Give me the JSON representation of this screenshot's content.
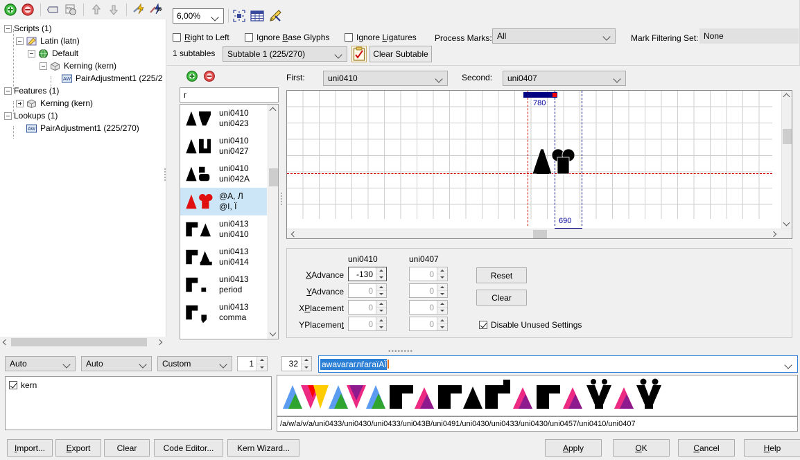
{
  "tree_toolbar": {
    "icons": [
      "add-icon",
      "remove-icon",
      "edit-icon",
      "xyz-icon",
      "move-up-icon",
      "move-down-icon",
      "merge-icon",
      "revert-icon"
    ],
    "overflow_label": "»"
  },
  "tree": {
    "nodes": [
      {
        "label": "Scripts (1)",
        "icon": "none",
        "depth": 0,
        "expander": "minus",
        "selected": false
      },
      {
        "label": "Latin (latn)",
        "icon": "script-icon",
        "depth": 1,
        "expander": "minus",
        "selected": false
      },
      {
        "label": "Default",
        "icon": "globe-icon",
        "depth": 2,
        "expander": "minus",
        "selected": false
      },
      {
        "label": "Kerning (kern)",
        "icon": "feature-icon",
        "depth": 3,
        "expander": "minus",
        "selected": false
      },
      {
        "label": "PairAdjustment1 (225/2",
        "icon": "lookup-icon",
        "depth": 4,
        "expander": "leaf",
        "selected": false
      },
      {
        "label": "Features (1)",
        "icon": "none",
        "depth": 0,
        "expander": "minus",
        "selected": false
      },
      {
        "label": "Kerning (kern)",
        "icon": "feature-icon",
        "depth": 1,
        "expander": "plus",
        "selected": false
      },
      {
        "label": "Lookups (1)",
        "icon": "none",
        "depth": 0,
        "expander": "minus",
        "selected": false
      },
      {
        "label": "PairAdjustment1 (225/270)",
        "icon": "lookup-icon",
        "depth": 1,
        "expander": "leaf",
        "selected": false
      }
    ]
  },
  "topbar": {
    "zoom_value": "6,00%",
    "icons": [
      "fit-to-selection-icon",
      "table-view-icon",
      "pen-edit-icon",
      "clipboard-icon"
    ],
    "checkboxes": [
      {
        "label": "Right to Left",
        "underline_index": 0,
        "checked": false
      },
      {
        "label": "Ignore Base Glyphs",
        "underline_index": 7,
        "checked": false
      },
      {
        "label": "Ignore Ligatures",
        "underline_index": 7,
        "checked": false
      }
    ],
    "process_marks_label": "Process Marks:",
    "process_marks_value": "All",
    "mark_filtering_label": "Mark Filtering Set:",
    "mark_filtering_value": "None",
    "subtable_count_label": "1 subtables",
    "subtable_value": "Subtable 1 (225/270)",
    "clear_subtable_label": "Clear Subtable"
  },
  "glyph_list": {
    "search_value": "г",
    "add_icon": "add-pair-icon",
    "remove_icon": "remove-pair-icon",
    "rows": [
      {
        "first": "uni0410",
        "second": "uni0423",
        "selected": false,
        "preview": "AT"
      },
      {
        "first": "uni0410",
        "second": "uni0427",
        "selected": false,
        "preview": "AU"
      },
      {
        "first": "uni0410",
        "second": "uni042A",
        "selected": false,
        "preview": "AB"
      },
      {
        "first": "@A, Л",
        "second": "@I, Ї",
        "selected": true,
        "preview": "AY"
      },
      {
        "first": "uni0413",
        "second": "uni0410",
        "selected": false,
        "preview": "GA"
      },
      {
        "first": "uni0413",
        "second": "uni0414",
        "selected": false,
        "preview": "GD"
      },
      {
        "first": "uni0413",
        "second": "period",
        "selected": false,
        "preview": "G."
      },
      {
        "first": "uni0413",
        "second": "comma",
        "selected": false,
        "preview": "G,"
      }
    ]
  },
  "pair": {
    "first_label": "First:",
    "first_value": "uni0410",
    "second_label": "Second:",
    "second_value": "uni0407",
    "first_advance": "780",
    "second_advance": "690"
  },
  "values": {
    "col1_header": "uni0410",
    "col2_header": "uni0407",
    "rows": [
      {
        "label": "XAdvance",
        "underline_index": 0,
        "col1": "-130",
        "col2": "0",
        "col1_enabled": true,
        "col2_enabled": false
      },
      {
        "label": "YAdvance",
        "underline_index": 0,
        "col1": "0",
        "col2": "0",
        "col1_enabled": false,
        "col2_enabled": false
      },
      {
        "label": "XPlacement",
        "underline_index": 1,
        "col1": "0",
        "col2": "0",
        "col1_enabled": false,
        "col2_enabled": false
      },
      {
        "label": "YPlacement",
        "underline_index": 9,
        "col1": "0",
        "col2": "0",
        "col1_enabled": false,
        "col2_enabled": false
      }
    ],
    "reset_label": "Reset",
    "clear_label": "Clear",
    "disable_unused_label": "Disable Unused Settings",
    "disable_unused_checked": true
  },
  "bottom": {
    "combo1": "Auto",
    "combo2": "Auto",
    "combo3": "Custom",
    "spin1": "1",
    "spin2": "32",
    "sample_text": "awavaгaглѓaгaїАЇ",
    "feature_items": [
      {
        "label": "kern",
        "checked": true
      }
    ],
    "glyph_names": "/a/w/a/v/a/uni0433/uni0430/uni0433/uni043B/uni0491/uni0430/uni0433/uni0430/uni0457/uni0410/uni0407"
  },
  "footer": {
    "left_buttons": [
      {
        "label": "Import...",
        "underline_index": 0
      },
      {
        "label": "Export",
        "underline_index": 0
      },
      {
        "label": "Clear",
        "underline_index": -1
      },
      {
        "label": "Code Editor...",
        "underline_index": -1
      },
      {
        "label": "Kern Wizard...",
        "underline_index": -1
      }
    ],
    "right_buttons": [
      {
        "label": "Apply",
        "underline_index": 0
      },
      {
        "label": "OK",
        "underline_index": 0
      },
      {
        "label": "Cancel",
        "underline_index": 0
      },
      {
        "label": "Help",
        "underline_index": 0
      }
    ]
  },
  "colors": {
    "accent_blue": "#2b7fd4",
    "advance_bar": "#000080",
    "handle_red": "#ff0000",
    "baseline_red": "#d40000",
    "selection": "#cce6f7",
    "glyph_pink": "#ec2a84",
    "glyph_purple": "#8e1b8e",
    "glyph_blue": "#5b9bf0",
    "glyph_green": "#2fa52f",
    "glyph_yellow": "#ffcc00",
    "glyph_red": "#ff0000",
    "glyph_black": "#000000"
  },
  "glyph_strip": {
    "glyphs": [
      {
        "shape": "aw",
        "colors": [
          "#5b9bf0",
          "#2fa52f",
          "#ec2a84",
          "#ff0000",
          "#ffcc00"
        ]
      },
      {
        "shape": "av",
        "colors": [
          "#5b9bf0",
          "#2fa52f",
          "#8e1b8e",
          "#ec2a84"
        ]
      },
      {
        "shape": "a",
        "colors": [
          "#5b9bf0",
          "#2fa52f"
        ]
      },
      {
        "shape": "g",
        "colors": [
          "#000000"
        ]
      },
      {
        "shape": "a",
        "colors": [
          "#ec2a84",
          "#8e1b8e"
        ]
      },
      {
        "shape": "g",
        "colors": [
          "#000000"
        ]
      },
      {
        "shape": "a",
        "colors": [
          "#000000"
        ]
      },
      {
        "shape": "g",
        "colors": [
          "#000000"
        ]
      },
      {
        "shape": "a",
        "colors": [
          "#ec2a84",
          "#8e1b8e"
        ]
      },
      {
        "shape": "g",
        "colors": [
          "#000000"
        ]
      },
      {
        "shape": "a",
        "colors": [
          "#ec2a84",
          "#8e1b8e"
        ]
      },
      {
        "shape": "y",
        "colors": [
          "#000000"
        ]
      },
      {
        "shape": "a",
        "colors": [
          "#ec2a84",
          "#8e1b8e"
        ]
      },
      {
        "shape": "y",
        "colors": [
          "#000000"
        ]
      }
    ]
  }
}
